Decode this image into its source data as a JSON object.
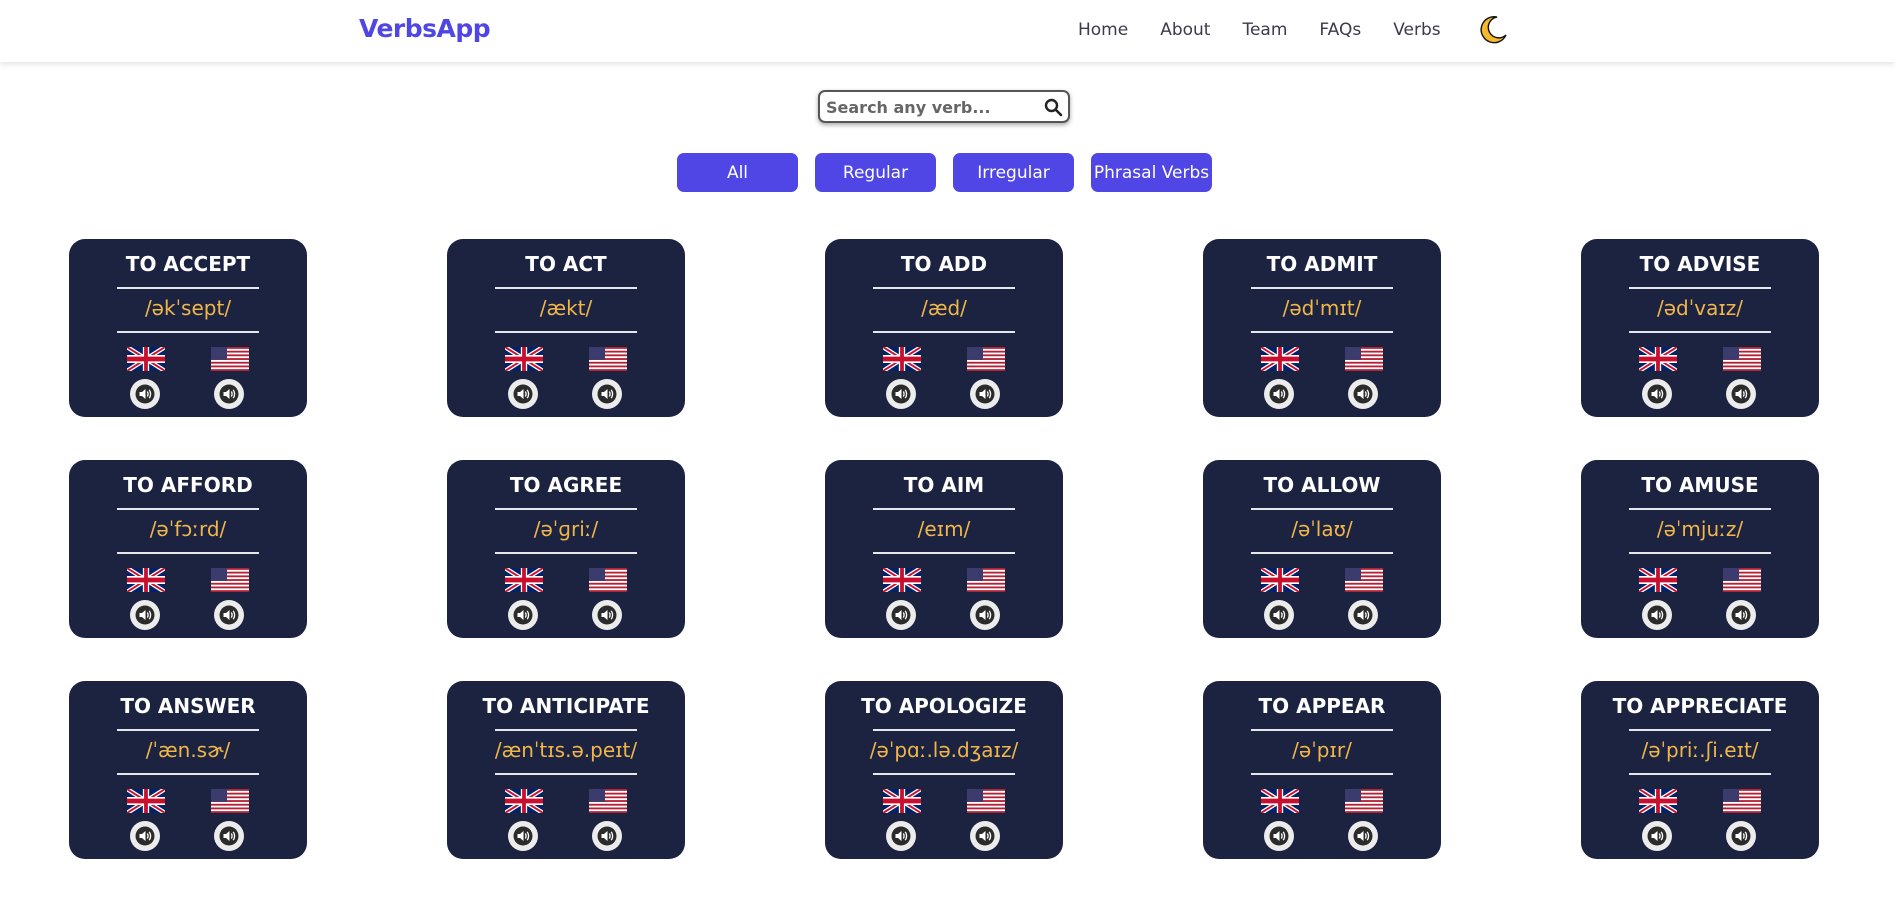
{
  "brand": "VerbsApp",
  "nav": [
    "Home",
    "About",
    "Team",
    "FAQs",
    "Verbs"
  ],
  "icons": {
    "theme_toggle": "moon-icon",
    "search": "search-icon",
    "flag_uk": "uk-flag-icon",
    "flag_us": "us-flag-icon",
    "audio": "speaker-icon"
  },
  "search": {
    "placeholder": "Search any verb...",
    "value": ""
  },
  "filters": [
    "All",
    "Regular",
    "Irregular",
    "Phrasal Verbs"
  ],
  "colors": {
    "accent": "#4f46e5",
    "card_bg": "#1c2340",
    "phonetic": "#f0b64a",
    "moon": "#f5b82e"
  },
  "verbs": [
    {
      "title": "TO ACCEPT",
      "phonetic": "/əkˈsept/"
    },
    {
      "title": "TO ACT",
      "phonetic": "/ækt/"
    },
    {
      "title": "TO ADD",
      "phonetic": "/æd/"
    },
    {
      "title": "TO ADMIT",
      "phonetic": "/ədˈmɪt/"
    },
    {
      "title": "TO ADVISE",
      "phonetic": "/ədˈvaɪz/"
    },
    {
      "title": "TO AFFORD",
      "phonetic": "/əˈfɔːrd/"
    },
    {
      "title": "TO AGREE",
      "phonetic": "/əˈɡriː/"
    },
    {
      "title": "TO AIM",
      "phonetic": "/eɪm/"
    },
    {
      "title": "TO ALLOW",
      "phonetic": "/əˈlaʊ/"
    },
    {
      "title": "TO AMUSE",
      "phonetic": "/əˈmjuːz/"
    },
    {
      "title": "TO ANSWER",
      "phonetic": "/ˈæn.sɚ/"
    },
    {
      "title": "TO ANTICIPATE",
      "phonetic": "/ænˈtɪs.ə.peɪt/"
    },
    {
      "title": "TO APOLOGIZE",
      "phonetic": "/əˈpɑː.lə.dʒaɪz/"
    },
    {
      "title": "TO APPEAR",
      "phonetic": "/əˈpɪr/"
    },
    {
      "title": "TO APPRECIATE",
      "phonetic": "/əˈpriː.ʃi.eɪt/"
    }
  ]
}
